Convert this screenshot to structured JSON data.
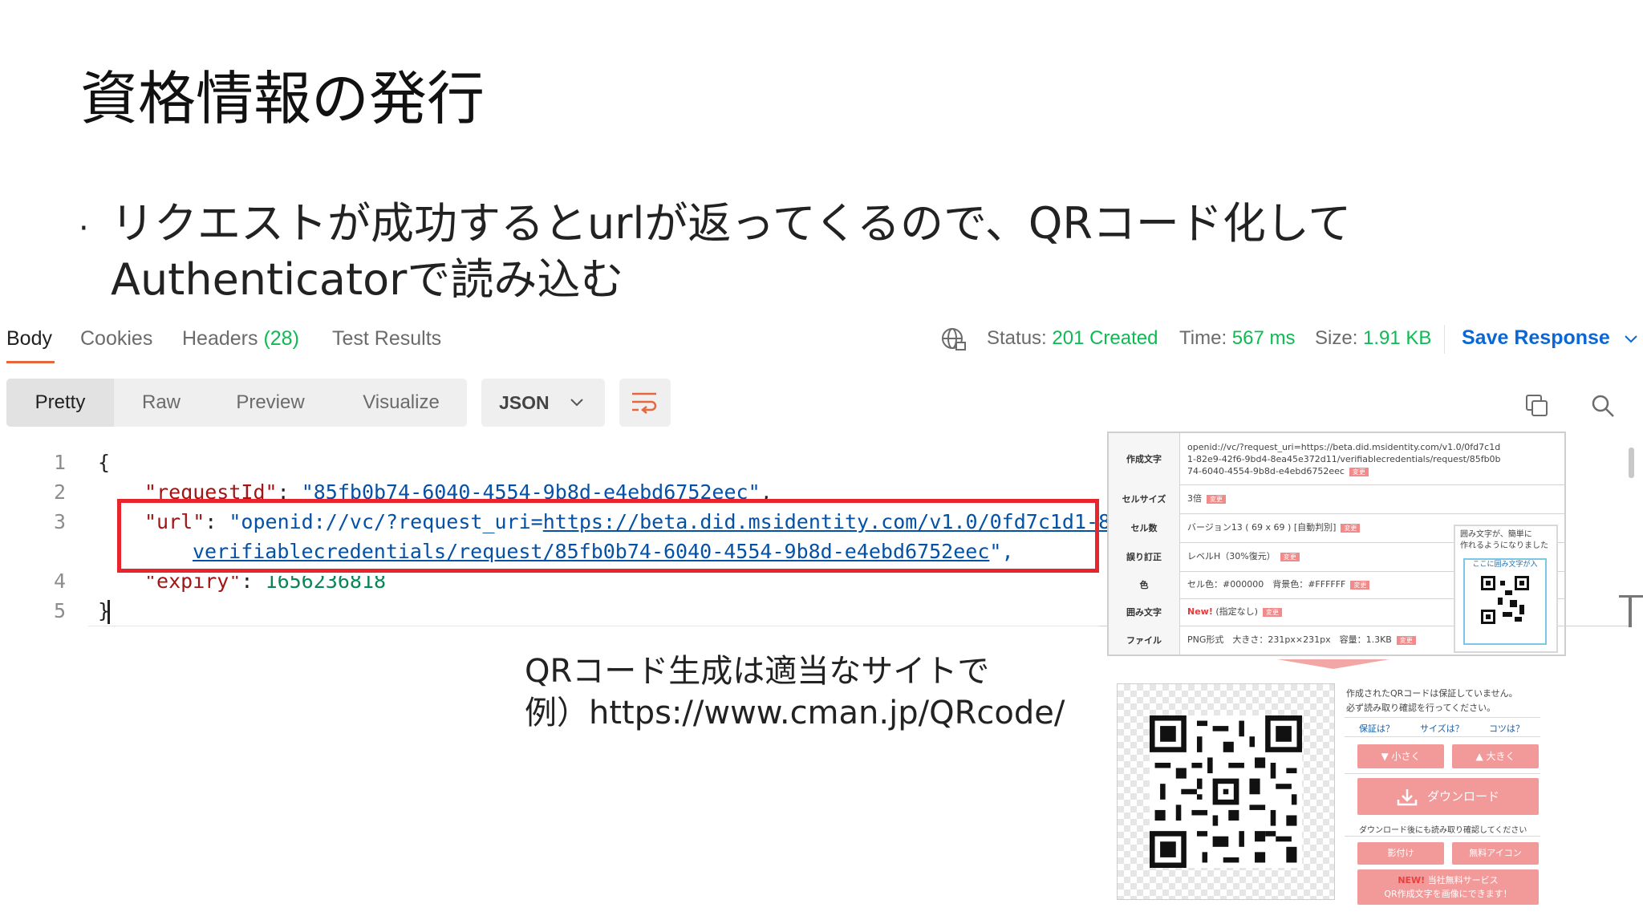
{
  "slide": {
    "title": "資格情報の発行",
    "bullet_line1": "リクエストが成功するとurlが返ってくるので、QRコード化して",
    "bullet_line2": "Authenticatorで読み込む",
    "caption_line1": "QRコード生成は適当なサイトで",
    "caption_line2": "例）https://www.cman.jp/QRcode/"
  },
  "response_tabs": [
    {
      "label": "Body"
    },
    {
      "label": "Cookies"
    },
    {
      "label": "Headers",
      "count": "(28)"
    },
    {
      "label": "Test Results"
    }
  ],
  "response_meta": {
    "status_label": "Status:",
    "status_value": "201 Created",
    "time_label": "Time:",
    "time_value": "567 ms",
    "size_label": "Size:",
    "size_value": "1.91 KB",
    "save_label": "Save Response"
  },
  "view_modes": [
    "Pretty",
    "Raw",
    "Preview",
    "Visualize"
  ],
  "format": "JSON",
  "code": {
    "line_numbers": [
      "1",
      "2",
      "3",
      "4",
      "5"
    ],
    "open_brace": "{",
    "close_brace": "}",
    "request_key": "\"requestId\"",
    "request_value": "\"85fb0b74-6040-4554-9b8d-e4ebd6752eec\"",
    "url_key": "\"url\"",
    "url_prefix": "\"openid://vc/?request_uri=",
    "url_link_1": "https://beta.did.msidentity.com/v1.0/0fd7c1d1-8",
    "url_link_2": "verifiablecredentials/request/85fb0b74-6040-4554-9b8d-e4ebd6752eec",
    "url_suffix": "\",",
    "expiry_key": "\"expiry\"",
    "expiry_value": "1656236818",
    "colon": ": ",
    "comma": ","
  },
  "qr_site": {
    "rows": [
      {
        "label": "作成文字",
        "lines": [
          "openid://vc/?request_uri=https://beta.did.msidentity.com/v1.0/0fd7c1d",
          "1-82e9-42f6-9bd4-8ea45e372d11/verifiablecredentials/request/85fb0b",
          "74-6040-4554-9b8d-e4ebd6752eec"
        ]
      },
      {
        "label": "セルサイズ",
        "lines": [
          "3倍"
        ]
      },
      {
        "label": "セル数",
        "lines": [
          "バージョン13 ( 69 x 69 ) [自動判別]"
        ]
      },
      {
        "label": "誤り訂正",
        "lines": [
          "レベルH（30%復元）"
        ]
      },
      {
        "label": "色",
        "lines": [
          "セル色：#000000　背景色：#FFFFFF"
        ]
      },
      {
        "label": "囲み文字",
        "new": "New!",
        "lines": [
          "(指定なし)"
        ]
      },
      {
        "label": "ファイル",
        "lines": [
          "PNG形式　大きさ：231px×231px　容量：1.3KB"
        ]
      }
    ],
    "tag": "変更",
    "callout_lines": [
      "囲み文字が、簡単に",
      "作れるようになりました"
    ],
    "callout_box": "ここに囲み文字が入",
    "note_line1": "作成されたQRコードは保証していません。",
    "note_line2": "必ず読み取り確認を行ってください。",
    "help_links": [
      "保証は？",
      "サイズは？",
      "コツは？"
    ],
    "smaller": "▼ 小さく",
    "larger": "▲ 大きく",
    "download": "ダウンロード",
    "download_note": "ダウンロード後にも読み取り確認してください",
    "shadow": "影付け",
    "free_icon": "無料アイコン",
    "promo_new": "NEW!",
    "promo_line1": "当社無料サービス",
    "promo_line2": "QR作成文字を画像にできます！"
  },
  "colors": {
    "accent": "#e8663c",
    "status_green": "#0cbb52",
    "link_blue": "#0b66d6",
    "highlight_red": "#e8242c"
  }
}
